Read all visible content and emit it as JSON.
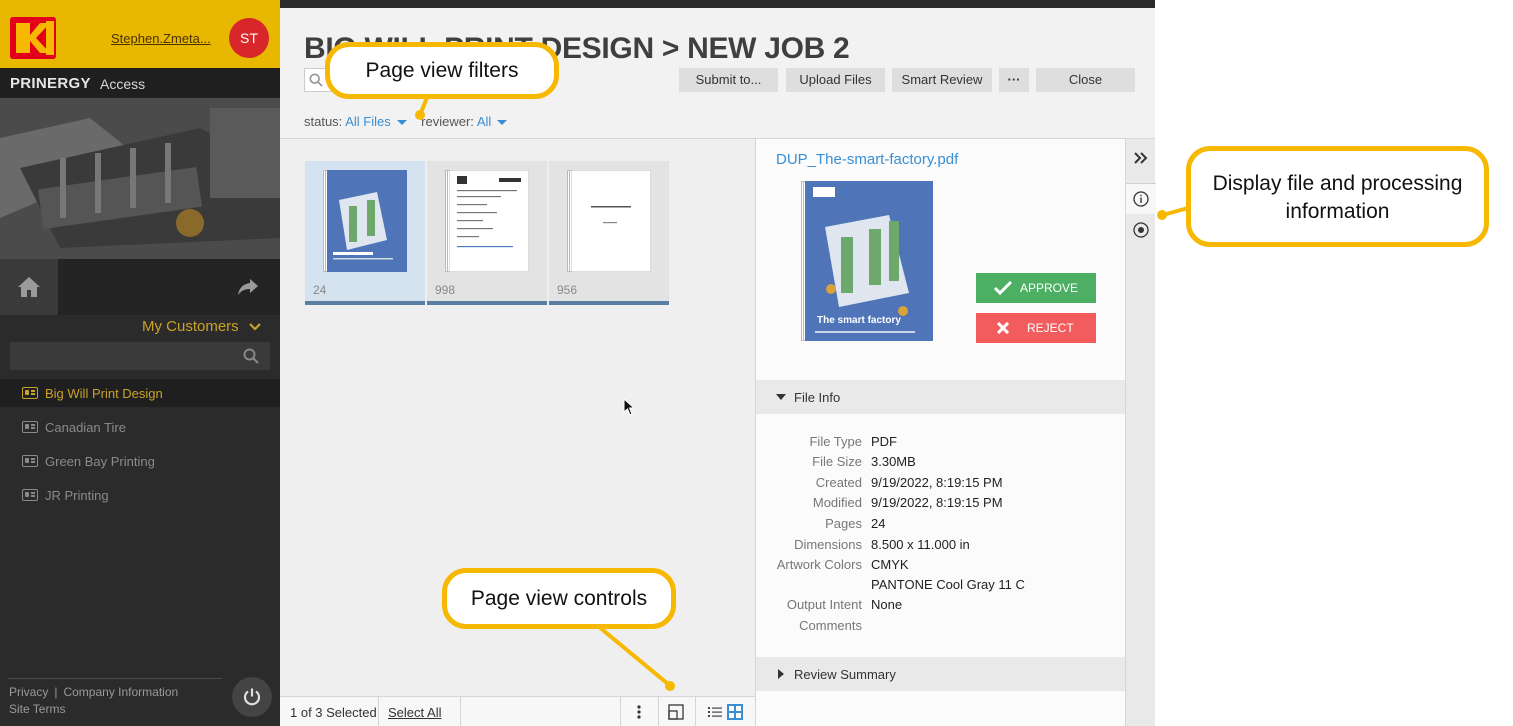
{
  "user": {
    "name": "Stephen.Zmeta...",
    "initials": "ST"
  },
  "brand": {
    "name": "PRINERGY",
    "sub": "Access",
    "logo_text": "KODAK"
  },
  "sidebar": {
    "customers_label": "My Customers",
    "search_placeholder": "",
    "customers": [
      {
        "label": "Big Will Print Design",
        "active": true
      },
      {
        "label": "Canadian Tire",
        "active": false
      },
      {
        "label": "Green Bay Printing",
        "active": false
      },
      {
        "label": "JR Printing",
        "active": false
      }
    ],
    "footer": {
      "privacy": "Privacy",
      "company": "Company Information",
      "site_terms": "Site Terms"
    }
  },
  "header": {
    "title": "BIG WILL PRINT DESIGN > NEW JOB 2",
    "buttons": {
      "submit": "Submit to...",
      "upload": "Upload Files",
      "smart_review": "Smart Review",
      "more": "···",
      "close": "Close"
    },
    "filters": {
      "status_label": "status:",
      "status_value": "All Files",
      "reviewer_label": "reviewer:",
      "reviewer_value": "All"
    }
  },
  "grid": {
    "pages": [
      {
        "count": "24",
        "selected": true
      },
      {
        "count": "998",
        "selected": false
      },
      {
        "count": "956",
        "selected": false
      }
    ]
  },
  "bottombar": {
    "selected_text": "1 of 3 Selected",
    "select_all": "Select All"
  },
  "detail": {
    "filename": "DUP_The-smart-factory.pdf",
    "approve": "APPROVE",
    "reject": "REJECT",
    "file_info_title": "File Info",
    "info": [
      {
        "key": "File Type",
        "value": "PDF"
      },
      {
        "key": "File Size",
        "value": "3.30MB"
      },
      {
        "key": "Created",
        "value": "9/19/2022, 8:19:15 PM"
      },
      {
        "key": "Modified",
        "value": "9/19/2022, 8:19:15 PM"
      },
      {
        "key": "Pages",
        "value": "24"
      },
      {
        "key": "Dimensions",
        "value": "8.500 x 11.000 in"
      },
      {
        "key": "Artwork Colors",
        "value": "CMYK"
      },
      {
        "key": "",
        "value": "PANTONE Cool Gray 11 C"
      },
      {
        "key": "Output Intent",
        "value": "None"
      },
      {
        "key": "Comments",
        "value": ""
      }
    ],
    "review_summary_title": "Review Summary",
    "cover_title": "The smart factory"
  },
  "callouts": {
    "filters": "Page view filters",
    "controls": "Page view controls",
    "info": "Display file and processing information"
  },
  "colors": {
    "accent": "#f6b800",
    "link": "#3a8fd4",
    "approve": "#4caf63",
    "reject": "#f25c5c",
    "sidebar": "#2b2b2b",
    "active": "#c9a227"
  }
}
